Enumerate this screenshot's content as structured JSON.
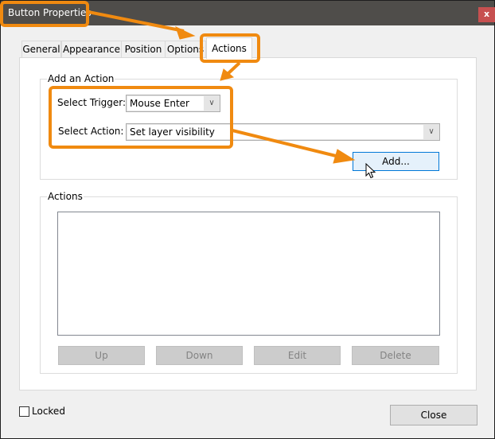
{
  "window": {
    "title": "Button Properties",
    "close_label": "x"
  },
  "tabs": [
    {
      "label": "General",
      "active": false
    },
    {
      "label": "Appearance",
      "active": false
    },
    {
      "label": "Position",
      "active": false
    },
    {
      "label": "Options",
      "active": false
    },
    {
      "label": "Actions",
      "active": true
    }
  ],
  "add_action": {
    "group_label": "Add an Action",
    "trigger_label": "Select Trigger:",
    "trigger_value": "Mouse Enter",
    "action_label": "Select Action:",
    "action_value": "Set layer visibility",
    "add_button": "Add..."
  },
  "actions": {
    "group_label": "Actions",
    "items": [],
    "buttons": {
      "up": "Up",
      "down": "Down",
      "edit": "Edit",
      "delete": "Delete"
    }
  },
  "footer": {
    "locked_label": "Locked",
    "locked_checked": false,
    "close_button": "Close"
  },
  "annotations": {
    "color": "#f08a10"
  },
  "icons": {
    "dropdown": "chevron-down-icon",
    "close": "close-icon",
    "cursor": "mouse-pointer-icon"
  }
}
